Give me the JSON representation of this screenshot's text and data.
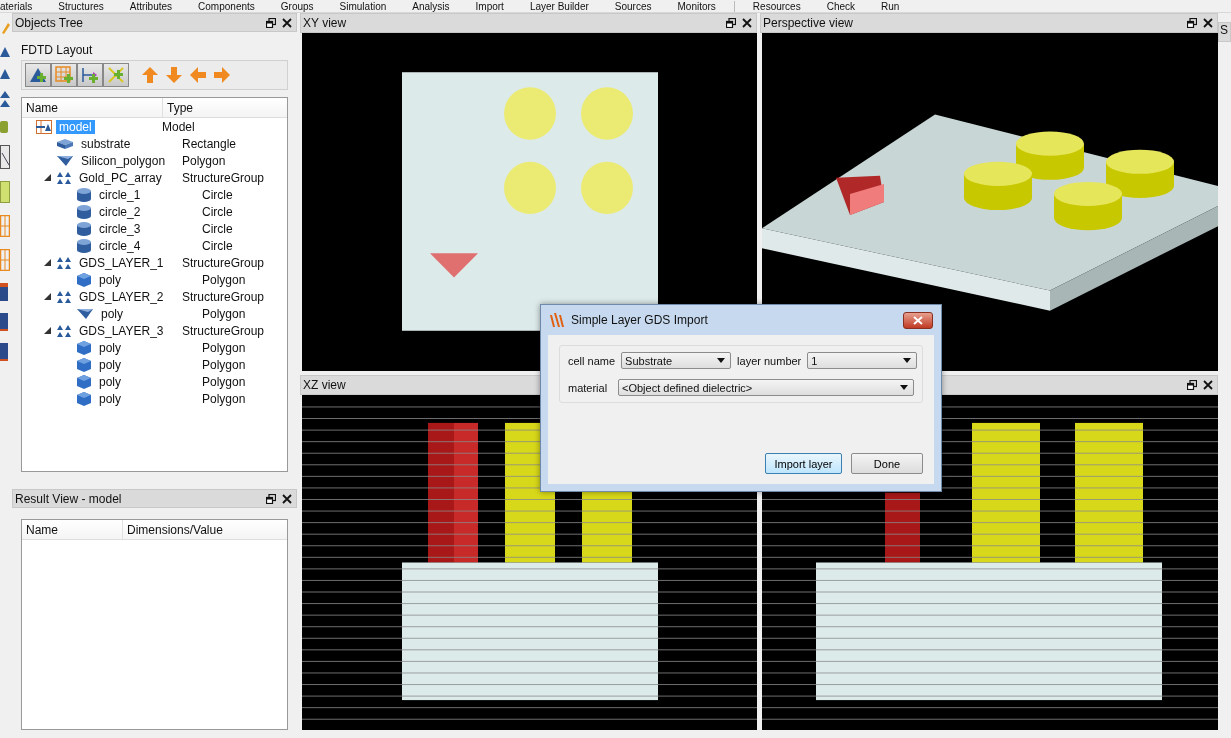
{
  "menu_tabs": [
    "aterials",
    "Structures",
    "Attributes",
    "Components",
    "Groups",
    "Simulation",
    "Analysis",
    "Import",
    "Layer Builder",
    "Sources",
    "Monitors",
    "Resources",
    "Check",
    "Run"
  ],
  "objects_tree": {
    "title": "Objects Tree",
    "layout_label": "FDTD Layout",
    "columns": [
      "Name",
      "Type"
    ],
    "items": [
      {
        "name": "model",
        "type": "Model",
        "kind": "model",
        "selected": true,
        "children": [
          {
            "name": "substrate",
            "type": "Rectangle",
            "kind": "rectangle",
            "selected": false
          },
          {
            "name": "Silicon_polygon",
            "type": "Polygon",
            "kind": "wedge",
            "selected": false
          },
          {
            "name": "Gold_PC_array",
            "type": "StructureGroup",
            "kind": "group",
            "selected": false,
            "expanded": true,
            "children": [
              {
                "name": "circle_1",
                "type": "Circle",
                "kind": "circle",
                "selected": false
              },
              {
                "name": "circle_2",
                "type": "Circle",
                "kind": "circle",
                "selected": false
              },
              {
                "name": "circle_3",
                "type": "Circle",
                "kind": "circle",
                "selected": false
              },
              {
                "name": "circle_4",
                "type": "Circle",
                "kind": "circle",
                "selected": false
              }
            ]
          },
          {
            "name": "GDS_LAYER_1",
            "type": "StructureGroup",
            "kind": "group",
            "selected": false,
            "expanded": true,
            "children": [
              {
                "name": "poly",
                "type": "Polygon",
                "kind": "prism",
                "selected": false
              }
            ]
          },
          {
            "name": "GDS_LAYER_2",
            "type": "StructureGroup",
            "kind": "group",
            "selected": false,
            "expanded": true,
            "children": [
              {
                "name": "poly",
                "type": "Polygon",
                "kind": "wedge",
                "selected": false
              }
            ]
          },
          {
            "name": "GDS_LAYER_3",
            "type": "StructureGroup",
            "kind": "group",
            "selected": false,
            "expanded": true,
            "children": [
              {
                "name": "poly",
                "type": "Polygon",
                "kind": "prism",
                "selected": false
              },
              {
                "name": "poly",
                "type": "Polygon",
                "kind": "prism",
                "selected": false
              },
              {
                "name": "poly",
                "type": "Polygon",
                "kind": "prism",
                "selected": false
              },
              {
                "name": "poly",
                "type": "Polygon",
                "kind": "prism",
                "selected": false
              }
            ]
          }
        ]
      }
    ]
  },
  "result_view": {
    "title": "Result View - model",
    "columns": [
      "Name",
      "Dimensions/Value"
    ]
  },
  "views": [
    {
      "title": "XY view",
      "kind": "xy"
    },
    {
      "title": "Perspective view",
      "kind": "perspective"
    },
    {
      "title": "XZ view",
      "kind": "xz"
    },
    {
      "kind": "yz"
    }
  ],
  "right_tab": "S",
  "dialog": {
    "title": "Simple Layer GDS Import",
    "fields": [
      {
        "label": "cell name",
        "value": "Substrate"
      },
      {
        "label": "layer number",
        "value": "1"
      },
      {
        "label": "material",
        "value": "<Object defined dielectric>"
      }
    ],
    "buttons": [
      {
        "label": "Import layer",
        "default": true
      },
      {
        "label": "Done",
        "default": false
      }
    ]
  }
}
